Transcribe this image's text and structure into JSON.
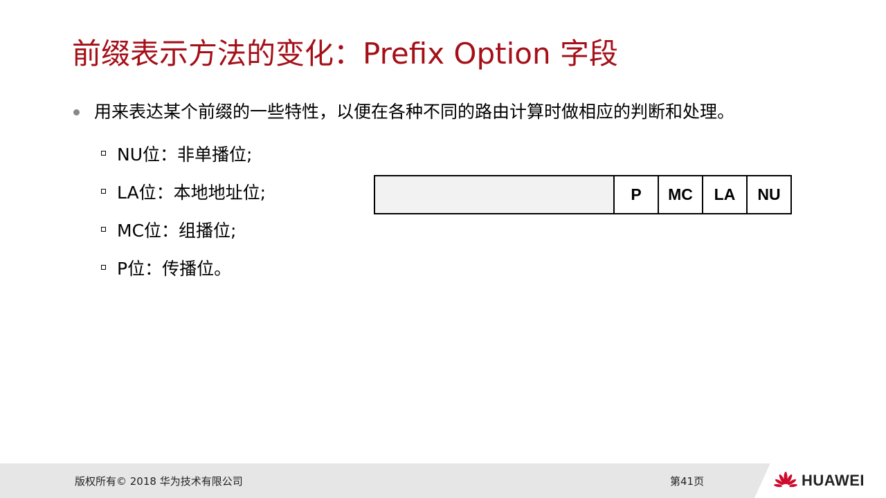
{
  "title": "前缀表示方法的变化：Prefix Option 字段",
  "main_bullet": "用来表达某个前缀的一些特性，以便在各种不同的路由计算时做相应的判断和处理。",
  "sub_bullets": [
    "NU位：非单播位;",
    "LA位：本地地址位;",
    "MC位：组播位;",
    "P位：传播位。"
  ],
  "field_table": {
    "cells": [
      "P",
      "MC",
      "LA",
      "NU"
    ]
  },
  "footer": {
    "copyright": "版权所有© 2018 华为技术有限公司",
    "page": "第41页",
    "brand": "HUAWEI"
  },
  "colors": {
    "title": "#a50f18",
    "logo_red": "#cf0a2c"
  }
}
